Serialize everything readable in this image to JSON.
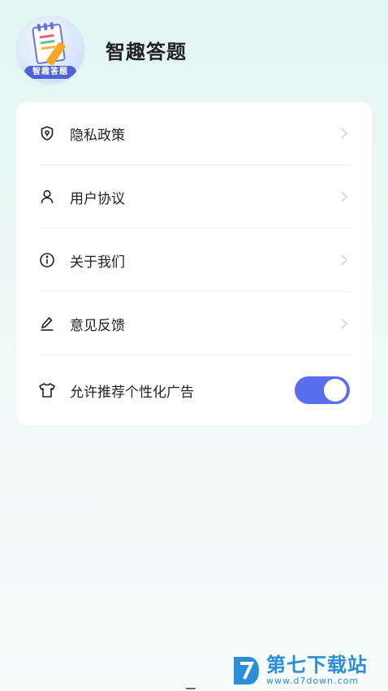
{
  "app": {
    "icon_badge": "智趣答题",
    "title": "智趣答题"
  },
  "menu": {
    "items": [
      {
        "label": "隐私政策",
        "icon": "shield-icon"
      },
      {
        "label": "用户协议",
        "icon": "user-icon"
      },
      {
        "label": "关于我们",
        "icon": "info-icon"
      },
      {
        "label": "意见反馈",
        "icon": "edit-icon"
      }
    ],
    "toggle_item": {
      "label": "允许推荐个性化广告",
      "icon": "shirt-icon",
      "enabled": true
    }
  },
  "colors": {
    "accent": "#5a6ef0",
    "background_top": "#e2f6f2",
    "watermark": "#2b8ed8"
  },
  "watermark": {
    "name": "第七下载站",
    "url": "www.d7down.com"
  }
}
